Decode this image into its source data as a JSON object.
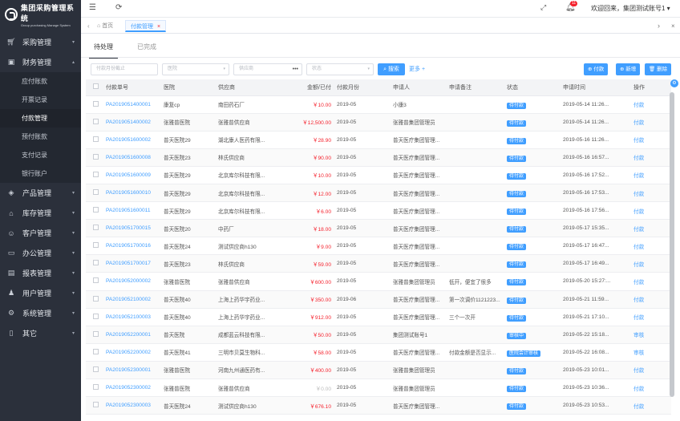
{
  "app": {
    "title": "集团采购管理系统",
    "subtitle": "Group purchasing Manage System"
  },
  "sidebar": {
    "menus": [
      {
        "label": "采购管理",
        "icon": "cart-icon",
        "open": false
      },
      {
        "label": "财务管理",
        "icon": "wallet-icon",
        "open": true,
        "children": [
          "应付账款",
          "开票记录",
          "付款管理",
          "预付账款",
          "支付记录",
          "银行账户"
        ],
        "active_child": "付款管理"
      },
      {
        "label": "产品管理",
        "icon": "box-icon",
        "open": false
      },
      {
        "label": "库存管理",
        "icon": "warehouse-icon",
        "open": false
      },
      {
        "label": "客户管理",
        "icon": "customer-icon",
        "open": false
      },
      {
        "label": "办公管理",
        "icon": "folder-icon",
        "open": false
      },
      {
        "label": "报表管理",
        "icon": "report-icon",
        "open": false
      },
      {
        "label": "用户管理",
        "icon": "user-icon",
        "open": false
      },
      {
        "label": "系统管理",
        "icon": "settings-icon",
        "open": false
      },
      {
        "label": "其它",
        "icon": "document-icon",
        "open": false
      }
    ]
  },
  "topbar": {
    "notification_count": "11",
    "welcome": "欢迎回来，集团测试账号1"
  },
  "tabs": {
    "home": "首页",
    "current": "付款管理"
  },
  "subtabs": {
    "pending": "待处理",
    "done": "已完成"
  },
  "filters": {
    "month_placeholder": "付款月份截止",
    "hospital_placeholder": "医院",
    "supplier_placeholder": "供应商",
    "status_placeholder": "状态",
    "search_label": "搜索",
    "more_label": "更多"
  },
  "actions": {
    "pay": "付款",
    "add": "新增",
    "delete": "删除"
  },
  "table": {
    "headers": [
      "付款单号",
      "医院",
      "供应商",
      "金额/已付",
      "付款月份",
      "申请人",
      "申请备注",
      "状态",
      "申请时间",
      "操作"
    ],
    "rows": [
      [
        "PA2019051400001",
        "康复cp",
        "南田药石厂",
        "￥10.00",
        "2019-05",
        "小康3",
        "",
        "待付款",
        "2019-05-14 11:26...",
        "付款"
      ],
      [
        "PA2019051400002",
        "张雅普医院",
        "张雅普供应商",
        "￥12,500.00",
        "2019-05",
        "张雅普集团管理员",
        "",
        "待付款",
        "2019-05-14 11:26...",
        "付款"
      ],
      [
        "PA2019051600002",
        "普天医院29",
        "湖北康人医药有限...",
        "￥28.90",
        "2019-05",
        "普天医疗集团管理...",
        "",
        "待付款",
        "2019-05-16 11:26...",
        "付款"
      ],
      [
        "PA2019051600008",
        "普天医院23",
        "林氏供应商",
        "￥90.00",
        "2019-05",
        "普天医疗集团管理...",
        "",
        "待付款",
        "2019-05-16 16:57...",
        "付款"
      ],
      [
        "PA2019051600009",
        "普天医院29",
        "北京库尔科技有限...",
        "￥10.00",
        "2019-05",
        "普天医疗集团管理...",
        "",
        "待付款",
        "2019-05-16 17:52...",
        "付款"
      ],
      [
        "PA2019051600010",
        "普天医院29",
        "北京库尔科技有限...",
        "￥12.00",
        "2019-05",
        "普天医疗集团管理...",
        "",
        "待付款",
        "2019-05-16 17:53...",
        "付款"
      ],
      [
        "PA2019051600011",
        "普天医院29",
        "北京库尔科技有限...",
        "￥6.00",
        "2019-05",
        "普天医疗集团管理...",
        "",
        "待付款",
        "2019-05-16 17:56...",
        "付款"
      ],
      [
        "PA2019051700015",
        "普天医院20",
        "中药厂",
        "￥18.00",
        "2019-05",
        "普天医疗集团管理...",
        "",
        "待付款",
        "2019-05-17 15:35...",
        "付款"
      ],
      [
        "PA2019051700016",
        "普天医院24",
        "测试供应商h130",
        "￥9.00",
        "2019-05",
        "普天医疗集团管理...",
        "",
        "待付款",
        "2019-05-17 16:47...",
        "付款"
      ],
      [
        "PA2019051700017",
        "普天医院23",
        "林氏供应商",
        "￥59.00",
        "2019-05",
        "普天医疗集团管理...",
        "",
        "待付款",
        "2019-05-17 16:49...",
        "付款"
      ],
      [
        "PA2019052000002",
        "张雅普医院",
        "张雅普供应商",
        "￥600.00",
        "2019-05",
        "张雅普集团管理员",
        "低开，便宜了很多",
        "待付款",
        "2019-05-20 15:27:...",
        "付款"
      ],
      [
        "PA2019052100002",
        "普天医院40",
        "上海上药华宇药业...",
        "￥350.00",
        "2019-06",
        "普天医疗集团管理...",
        "第一次调价1121223...",
        "待付款",
        "2019-05-21 11:59...",
        "付款"
      ],
      [
        "PA2019052100003",
        "普天医院40",
        "上海上药华宇药业...",
        "￥912.00",
        "2019-05",
        "普天医疗集团管理...",
        "三个一次开",
        "待付款",
        "2019-05-21 17:10...",
        "付款"
      ],
      [
        "PA2019052200001",
        "普天医院",
        "成都蓝云科技有限...",
        "￥50.00",
        "2019-05",
        "集团测试账号1",
        "",
        "审核中",
        "2019-05-22 15:18...",
        "审核"
      ],
      [
        "PA2019052200002",
        "普天医院41",
        "三明市贝莫生物科...",
        "￥58.00",
        "2019-05",
        "普天医疗集团管理...",
        "付款金额是否显示...",
        "医院会计审核",
        "2019-05-22 16:08...",
        "审核"
      ],
      [
        "PA2019052300001",
        "张雅普医院",
        "河南九州通医药有...",
        "￥400.00",
        "2019-05",
        "张雅普集团管理员",
        "",
        "待付款",
        "2019-05-23 10:01...",
        "付款"
      ],
      [
        "PA2019052300002",
        "张雅普医院",
        "张雅普供应商",
        "￥0.00",
        "2019-05",
        "张雅普集团管理员",
        "",
        "待付款",
        "2019-05-23 10:36...",
        "付款"
      ],
      [
        "PA2019052300003",
        "普天医院24",
        "测试供应商h130",
        "￥676.10",
        "2019-05",
        "普天医疗集团管理...",
        "",
        "待付款",
        "2019-05-23 10:53...",
        "付款"
      ]
    ]
  },
  "colors": {
    "sidebar_bg": "#2b303b",
    "accent": "#409eff",
    "money": "#f5222d"
  }
}
